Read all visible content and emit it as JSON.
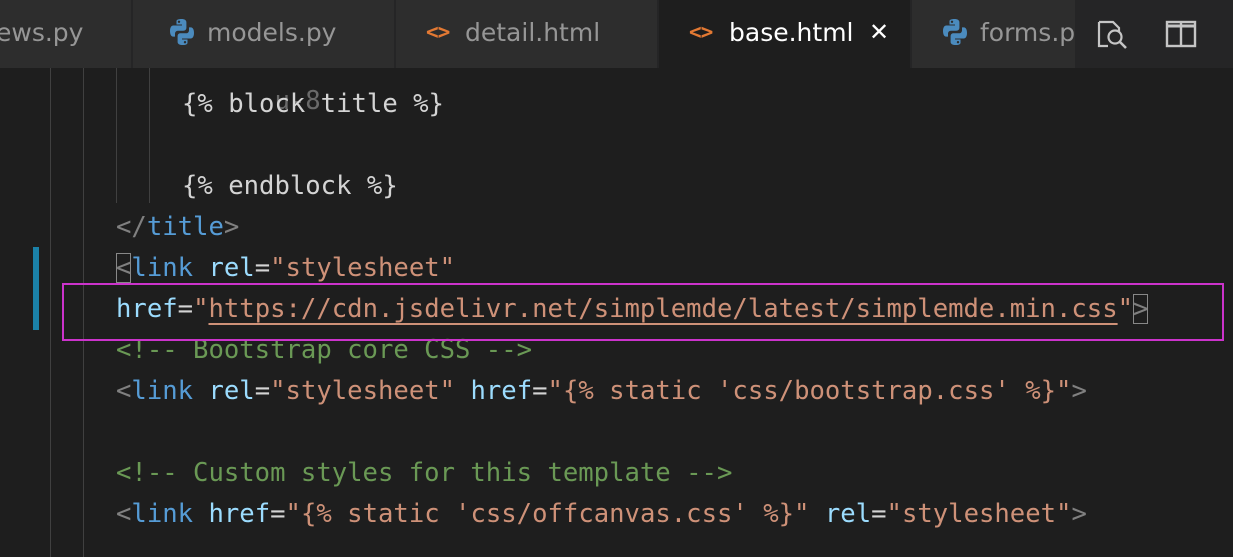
{
  "tabs": [
    {
      "label": "ews.py",
      "icon": "python-icon",
      "active": false
    },
    {
      "label": "models.py",
      "icon": "python-icon",
      "active": false
    },
    {
      "label": "detail.html",
      "icon": "html-icon",
      "active": false
    },
    {
      "label": "base.html",
      "icon": "html-icon",
      "active": true,
      "close": "✕"
    },
    {
      "label": "forms.p",
      "icon": "python-icon",
      "active": false
    }
  ],
  "tab_actions": [
    {
      "icon": "open-changes-icon"
    },
    {
      "icon": "split-editor-icon"
    }
  ],
  "html_glyph": "<>",
  "editor": {
    "lines": [
      {
        "tokens": [
          [
            "text",
            "{% block title %}"
          ]
        ]
      },
      {
        "tokens": [
          [
            "text",
            "{% endblock %}"
          ]
        ]
      },
      {
        "tokens": [
          [
            "punct",
            "</"
          ],
          [
            "tag",
            "title"
          ],
          [
            "punct",
            ">"
          ]
        ]
      },
      {
        "tokens": [
          [
            "punct",
            "<"
          ],
          [
            "tag",
            "link"
          ],
          [
            "text",
            " "
          ],
          [
            "attr",
            "rel"
          ],
          [
            "eq",
            "="
          ],
          [
            "str",
            "\"stylesheet\""
          ]
        ]
      },
      {
        "tokens": [
          [
            "attr",
            "href"
          ],
          [
            "eq",
            "="
          ],
          [
            "str",
            "\""
          ],
          [
            "link",
            "https://cdn.jsdelivr.net/simplemde/latest/simplemde.min.css"
          ],
          [
            "str",
            "\""
          ],
          [
            "punct",
            ">"
          ]
        ]
      },
      {
        "tokens": [
          [
            "cmt",
            "<!-- Bootstrap core CSS -->"
          ]
        ]
      },
      {
        "tokens": [
          [
            "punct",
            "<"
          ],
          [
            "tag",
            "link"
          ],
          [
            "text",
            " "
          ],
          [
            "attr",
            "rel"
          ],
          [
            "eq",
            "="
          ],
          [
            "str",
            "\"stylesheet\""
          ],
          [
            "text",
            " "
          ],
          [
            "attr",
            "href"
          ],
          [
            "eq",
            "="
          ],
          [
            "str",
            "\"{% static 'css/bootstrap.css' %}\""
          ],
          [
            "punct",
            ">"
          ]
        ]
      },
      {
        "tokens": [
          [
            "cmt",
            "<!-- Custom styles for this template -->"
          ]
        ]
      },
      {
        "tokens": [
          [
            "punct",
            "<"
          ],
          [
            "tag",
            "link"
          ],
          [
            "text",
            " "
          ],
          [
            "attr",
            "href"
          ],
          [
            "eq",
            "="
          ],
          [
            "str",
            "\"{% static 'css/offcanvas.css' %}\""
          ],
          [
            "text",
            " "
          ],
          [
            "attr",
            "rel"
          ],
          [
            "eq",
            "="
          ],
          [
            "str",
            "\"stylesheet\""
          ],
          [
            "punct",
            ">"
          ]
        ]
      }
    ]
  },
  "colors": {
    "background": "#1e1e1e",
    "tag": "#569cd6",
    "attribute": "#9cdcfe",
    "string": "#ce9178",
    "comment": "#6a9955",
    "punctuation": "#808080",
    "git_modified": "#1b81a8",
    "highlight_box": "#cc33cc"
  }
}
